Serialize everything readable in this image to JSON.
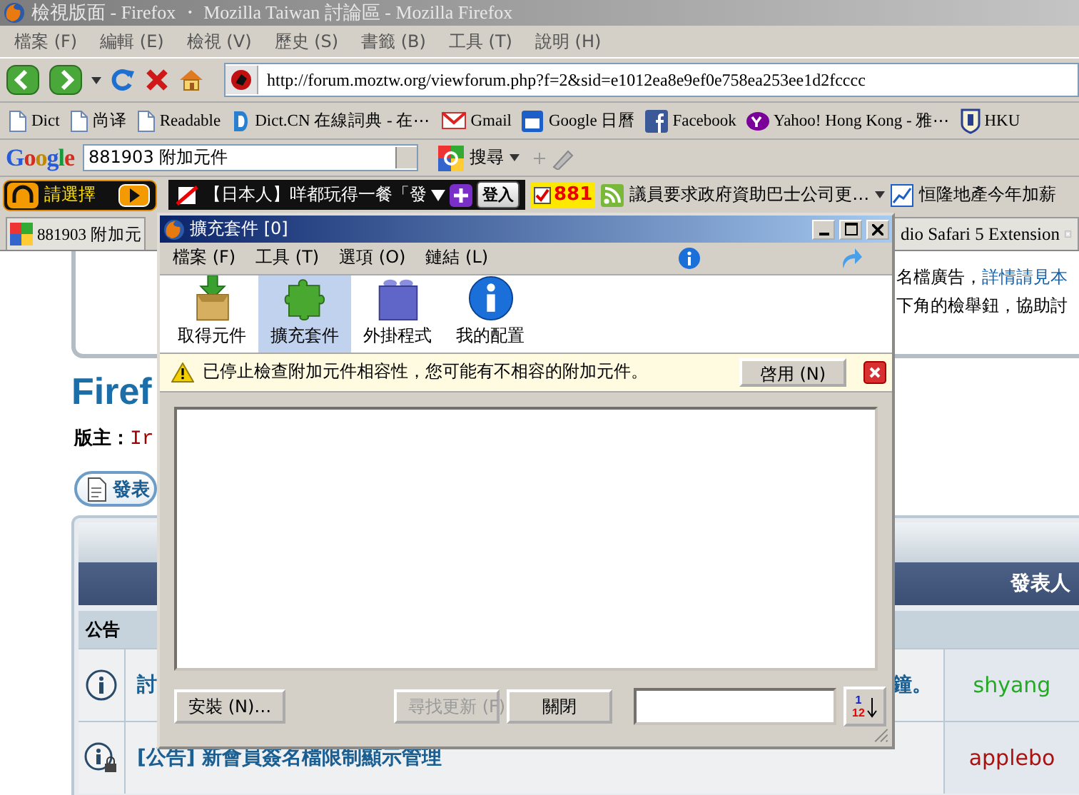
{
  "window": {
    "title": "檢視版面 - Firefox ・ Mozilla Taiwan 討論區 - Mozilla Firefox"
  },
  "menu_bar": [
    "檔案 (F)",
    "編輯 (E)",
    "檢視 (V)",
    "歷史 (S)",
    "書籤 (B)",
    "工具 (T)",
    "說明 (H)"
  ],
  "navigation": {
    "url": "http://forum.moztw.org/viewforum.php?f=2&sid=e1012ea8e9ef0e758ea253ee1d2fcccc"
  },
  "bookmarks": [
    {
      "label": "Dict",
      "kind": "page"
    },
    {
      "label": "尚译",
      "kind": "page"
    },
    {
      "label": "Readable",
      "kind": "page"
    },
    {
      "label": "Dict.CN 在線詞典 - 在⋯",
      "kind": "dict"
    },
    {
      "label": "Gmail",
      "kind": "mail"
    },
    {
      "label": "Google 日曆",
      "kind": "calendar"
    },
    {
      "label": "Facebook",
      "kind": "facebook"
    },
    {
      "label": "Yahoo! Hong Kong - 雅⋯",
      "kind": "yahoo"
    },
    {
      "label": "HKU",
      "kind": "crest"
    }
  ],
  "google_toolbar": {
    "logo": "Google",
    "query": "881903 附加元件",
    "search_button": "搜尋"
  },
  "addon_toolbar": {
    "station_select": "請選擇",
    "ticker": "【日本人】咩都玩得一餐「發",
    "login_button": "登入",
    "radio_label": "881",
    "radio_checked": true,
    "headline": "議員要求政府資助巴士公司更…",
    "stock_headline": "恒隆地產今年加薪"
  },
  "tabs": [
    {
      "label": "881903 附加元",
      "selected": false
    },
    {
      "label": "dio Safari 5 Extension",
      "selected": false
    }
  ],
  "page": {
    "notice_lines": [
      [
        "名檔廣告，",
        "詳情請見本"
      ],
      [
        "下角的檢舉鈕，協助討"
      ]
    ],
    "heading": "Firef",
    "moderator_label": "版主：",
    "moderator_name": "Ir",
    "post_button": "發表",
    "table": {
      "author_header": "發表人",
      "section": "公告",
      "rows": [
        {
          "title_parts": [
            "討",
            "鐘。"
          ],
          "author": "shyang",
          "color": "#22aa22",
          "locked": false
        },
        {
          "title_parts": [
            "[公告] 新會員簽名檔限制顯示管理"
          ],
          "author": "applebo",
          "color": "#aa1111",
          "locked": true
        }
      ]
    }
  },
  "addons_dialog": {
    "title": "擴充套件 [0]",
    "menu": [
      "檔案 (F)",
      "工具 (T)",
      "選項 (O)",
      "鏈結 (L)"
    ],
    "panes": [
      {
        "label": "取得元件",
        "kind": "get",
        "selected": false
      },
      {
        "label": "擴充套件",
        "kind": "extensions",
        "selected": true
      },
      {
        "label": "外掛程式",
        "kind": "plugins",
        "selected": false
      },
      {
        "label": "我的配置",
        "kind": "info",
        "selected": false
      }
    ],
    "warning": {
      "text": "已停止檢查附加元件相容性，您可能有不相容的附加元件。",
      "button": "啓用 (N)"
    },
    "buttons": [
      {
        "label": "安裝 (N)…",
        "disabled": false
      },
      {
        "label": "尋找更新 (F)",
        "disabled": true
      },
      {
        "label": "關閉",
        "disabled": false
      }
    ],
    "sort_labels": [
      "1",
      "12"
    ]
  }
}
